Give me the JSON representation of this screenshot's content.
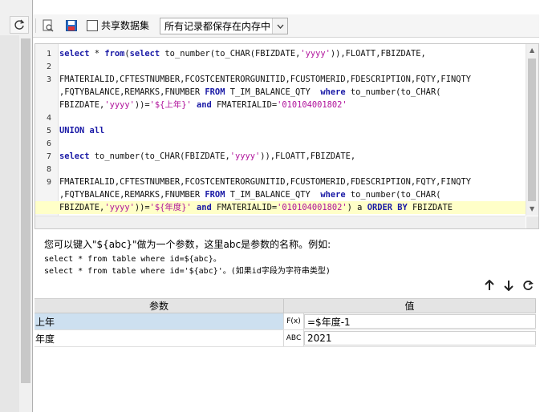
{
  "toolbar": {
    "share_label": "共享数据集",
    "storage_select": "所有记录都保存在内存中"
  },
  "editor": {
    "lines": [
      {
        "n": "1",
        "html": "<span class='kw'>select</span> * <span class='kw'>from</span>(<span class='kw'>select</span> to_number(to_CHAR(FBIZDATE,<span class='str'>'yyyy'</span>)),FLOATT,FBIZDATE,"
      },
      {
        "n": "2",
        "html": ""
      },
      {
        "n": "3",
        "html": "FMATERIALID,CFTESTNUMBER,FCOSTCENTERORGUNITID,FCUSTOMERID,FDESCRIPTION,FQTY,FINQTY"
      },
      {
        "n": "",
        "html": ",FQTYBALANCE,REMARKS,FNUMBER <span class='kw'>FROM</span> T_IM_BALANCE_QTY  <span class='kw'>where</span> to_number(to_CHAR("
      },
      {
        "n": "",
        "html": "FBIZDATE,<span class='str'>'yyyy'</span>))=<span class='str'>'${上年}'</span> <span class='kw'>and</span> FMATERIALID=<span class='str'>'010104001802'</span>"
      },
      {
        "n": "4",
        "html": ""
      },
      {
        "n": "5",
        "html": "<span class='kw'>UNION all</span>"
      },
      {
        "n": "6",
        "html": ""
      },
      {
        "n": "7",
        "html": "<span class='kw'>select</span> to_number(to_CHAR(FBIZDATE,<span class='str'>'yyyy'</span>)),FLOATT,FBIZDATE,"
      },
      {
        "n": "8",
        "html": ""
      },
      {
        "n": "9",
        "html": "FMATERIALID,CFTESTNUMBER,FCOSTCENTERORGUNITID,FCUSTOMERID,FDESCRIPTION,FQTY,FINQTY"
      },
      {
        "n": "",
        "html": ",FQTYBALANCE,REMARKS,FNUMBER <span class='kw'>FROM</span> T_IM_BALANCE_QTY  <span class='kw'>where</span> to_number(to_CHAR("
      },
      {
        "n": "",
        "html": "FBIZDATE,<span class='str'>'yyyy'</span>))=<span class='str'>'${年度}'</span> <span class='kw'>and</span> FMATERIALID=<span class='str'>'010104001802'</span>) a <span class='kw'>ORDER BY</span> FBIZDATE",
        "highlight": true
      }
    ]
  },
  "help": {
    "title": "您可以键入\"${abc}\"做为一个参数，这里abc是参数的名称。例如:",
    "example1": "select * from table where id=${abc}。",
    "example2": "select * from table where id='${abc}'。(如果id字段为字符串类型)"
  },
  "params": {
    "header_name": "参数",
    "header_value": "值",
    "rows": [
      {
        "name": "上年",
        "icon": "F(x)",
        "value": "=$年度-1",
        "selected": true
      },
      {
        "name": "年度",
        "icon": "ABC",
        "value": "2021",
        "selected": false
      }
    ]
  }
}
